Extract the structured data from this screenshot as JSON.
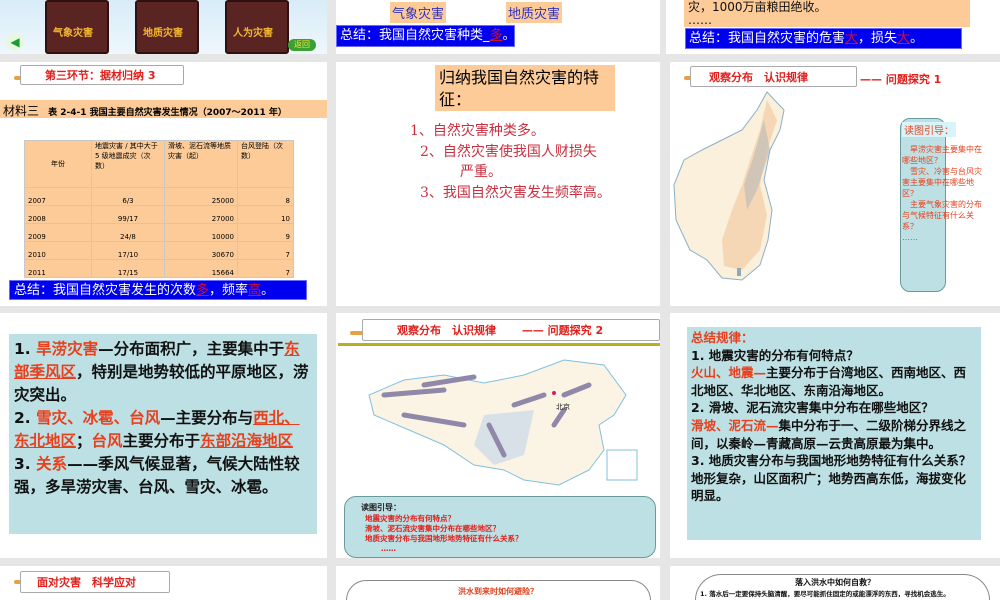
{
  "row0": {
    "slide1": {
      "chests": [
        "气象灾害",
        "地质灾害",
        "人为灾害"
      ],
      "back_label": "返回"
    },
    "slide2": {
      "tags": [
        "气象灾害",
        "地质灾害"
      ],
      "summary_prefix": "总结：我国自然灾害种类_",
      "summary_hl": "多",
      "summary_suffix": "。"
    },
    "slide3": {
      "text_line": "灾，1000万亩粮田绝收。",
      "ellipsis": "……",
      "summary_a": "总结：我国自然灾害的危害",
      "hl1": "大",
      "summary_b": "，损失",
      "hl2": "大",
      "summary_c": "。"
    }
  },
  "row1": {
    "slide1": {
      "title": "第三环节：据材归纳 3",
      "material_label": "材料三",
      "table_caption": "表 2-4-1  我国主要自然灾害发生情况（2007～2011 年）",
      "headers": [
        "年份",
        "地震灾害 / 其中大于 5 级地震成灾（次数）",
        "滑坡、泥石流等地质灾害（起）",
        "台风登陆（次数）"
      ],
      "rows": [
        [
          "2007",
          "6/3",
          "25000",
          "8"
        ],
        [
          "2008",
          "99/17",
          "27000",
          "10"
        ],
        [
          "2009",
          "24/8",
          "10000",
          "9"
        ],
        [
          "2010",
          "17/10",
          "30670",
          "7"
        ],
        [
          "2011",
          "17/15",
          "15664",
          "7"
        ]
      ],
      "summary_a": "总结：我国自然灾害发生的次数",
      "hl1": "多",
      "summary_b": "，频率",
      "hl2": "高",
      "summary_c": "。"
    },
    "slide2": {
      "title": "归纳我国自然灾害的特征：",
      "items": [
        "1、自然灾害种类多。",
        "2、自然灾害使我国人财损失",
        "严重。",
        "3、我国自然灾害发生频率高。"
      ]
    },
    "slide3": {
      "title": "观察分布　认识规律",
      "subtitle": "—— 问题探究 1",
      "guide_title": "读图引导：",
      "guide_lines": [
        "　旱涝灾害主要集中在哪些地区？",
        "　雪灾、冷害与台风灾害主要集中在哪些地区？",
        "　主要气象灾害的分布与气候特征有什么关系？",
        "……"
      ]
    }
  },
  "row2": {
    "slide1": {
      "p1_num": "1. ",
      "p1_red": "旱涝灾害",
      "p1_a": "—分布面积广，主要集中于",
      "p1_ul": "东部季风区",
      "p1_b": "，特别是地势较低的平原地区，涝灾突出。",
      "p2_num": "2. ",
      "p2_red": "雪灾、冰雹、台风",
      "p2_a": "—主要分布与",
      "p2_ul1": "西北、东北地区",
      "p2_b": "；",
      "p2_red2": "台风",
      "p2_c": "主要分布于",
      "p2_ul2": "东部沿海地区",
      "p3_num": "3. ",
      "p3_red": "关系",
      "p3_a": "——季风气候显著，气候大陆性较强，多旱涝灾害、台风、雪灾、冰雹。"
    },
    "slide2": {
      "title": "观察分布　认识规律",
      "subtitle": "—— 问题探究 2",
      "map_beijing": "北京",
      "guide_title": "读图引导：",
      "guide_lines": [
        "地震灾害的分布有何特点？",
        "滑坡、泥石流灾害集中分布在哪些地区？",
        "地质灾害分布与我国地形地势特征有什么关系？",
        "……"
      ]
    },
    "slide3": {
      "heading": "总结规律：",
      "q1": "1. 地震灾害的分布有何特点？",
      "a1_red": "火山、地震—",
      "a1": "主要分布于台湾地区、西南地区、西北地区、华北地区、东南沿海地区。",
      "q2": "2. 滑坡、泥石流灾害集中分布在哪些地区？",
      "a2_red": "滑坡、泥石流—",
      "a2": "集中分布于一、二级阶梯分界线之间，以秦岭—青藏高原—云贵高原最为集中。",
      "q3": "3. 地质灾害分布与我国地形地势特征有什么关系？",
      "a3": "地形复杂，山区面积广；地势西高东低，海拔变化明显。"
    }
  },
  "row3": {
    "slide1": {
      "title": "面对灾害　科学应对"
    },
    "slide2": {
      "title": "洪水到来时如何避险？"
    },
    "slide3": {
      "title": "落入洪水中如何自救？",
      "line1": "1. 落水后一定要保持头脑清醒，要尽可能抓住固定的或能漂浮的东西，寻找机会逃生。"
    }
  }
}
